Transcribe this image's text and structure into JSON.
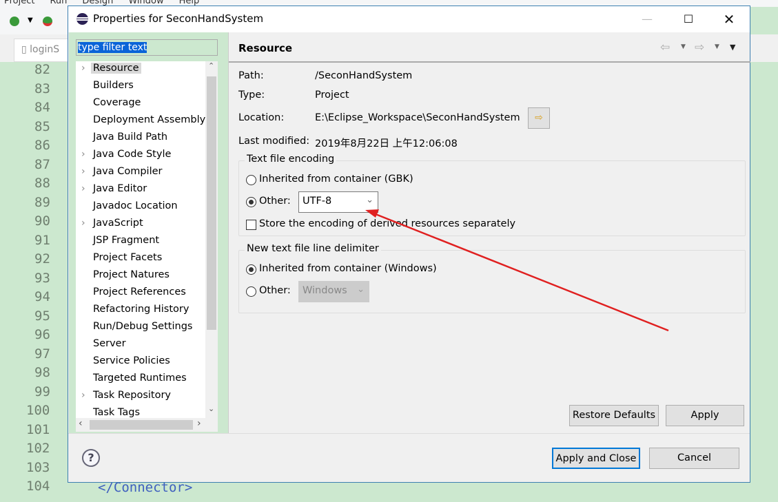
{
  "ide": {
    "menu": [
      "Project",
      "Run",
      "Design",
      "Window",
      "Help"
    ],
    "editor_tab": "loginS",
    "line_numbers": [
      "82",
      "83",
      "84",
      "85",
      "86",
      "87",
      "88",
      "89",
      "90",
      "91",
      "92",
      "93",
      "94",
      "95",
      "96",
      "97",
      "98",
      "99",
      "100",
      "101",
      "102",
      "103",
      "104"
    ],
    "code_line": "</Connector>",
    "colors": {
      "editor_bg": "#cce8cf",
      "accent": "#0a64d8",
      "annotation": "#e02020"
    }
  },
  "dialog": {
    "title": "Properties for SeconHandSystem",
    "filter_placeholder": "type filter text",
    "tree": [
      {
        "label": "Resource",
        "expandable": true,
        "selected": true
      },
      {
        "label": "Builders",
        "expandable": false
      },
      {
        "label": "Coverage",
        "expandable": false
      },
      {
        "label": "Deployment Assembly",
        "expandable": false
      },
      {
        "label": "Java Build Path",
        "expandable": false
      },
      {
        "label": "Java Code Style",
        "expandable": true
      },
      {
        "label": "Java Compiler",
        "expandable": true
      },
      {
        "label": "Java Editor",
        "expandable": true
      },
      {
        "label": "Javadoc Location",
        "expandable": false
      },
      {
        "label": "JavaScript",
        "expandable": true
      },
      {
        "label": "JSP Fragment",
        "expandable": false
      },
      {
        "label": "Project Facets",
        "expandable": false
      },
      {
        "label": "Project Natures",
        "expandable": false
      },
      {
        "label": "Project References",
        "expandable": false
      },
      {
        "label": "Refactoring History",
        "expandable": false
      },
      {
        "label": "Run/Debug Settings",
        "expandable": false
      },
      {
        "label": "Server",
        "expandable": false
      },
      {
        "label": "Service Policies",
        "expandable": false
      },
      {
        "label": "Targeted Runtimes",
        "expandable": false
      },
      {
        "label": "Task Repository",
        "expandable": true
      },
      {
        "label": "Task Tags",
        "expandable": false
      }
    ],
    "page": {
      "title": "Resource",
      "path_label": "Path:",
      "path": "/SeconHandSystem",
      "type_label": "Type:",
      "type": "Project",
      "location_label": "Location:",
      "location": "E:\\Eclipse_Workspace\\SeconHandSystem",
      "modified_label": "Last modified:",
      "modified": "2019年8月22日 上午12:06:08",
      "encoding": {
        "title": "Text file encoding",
        "inherited": "Inherited from container (GBK)",
        "other": "Other:",
        "other_selected": true,
        "value": "UTF-8",
        "store_derived": "Store the encoding of derived resources separately",
        "store_derived_checked": false
      },
      "delimiter": {
        "title": "New text file line delimiter",
        "inherited": "Inherited from container (Windows)",
        "inherited_selected": true,
        "other": "Other:",
        "value": "Windows"
      },
      "restore_defaults": "Restore Defaults",
      "apply": "Apply"
    },
    "apply_close": "Apply and Close",
    "cancel": "Cancel"
  }
}
